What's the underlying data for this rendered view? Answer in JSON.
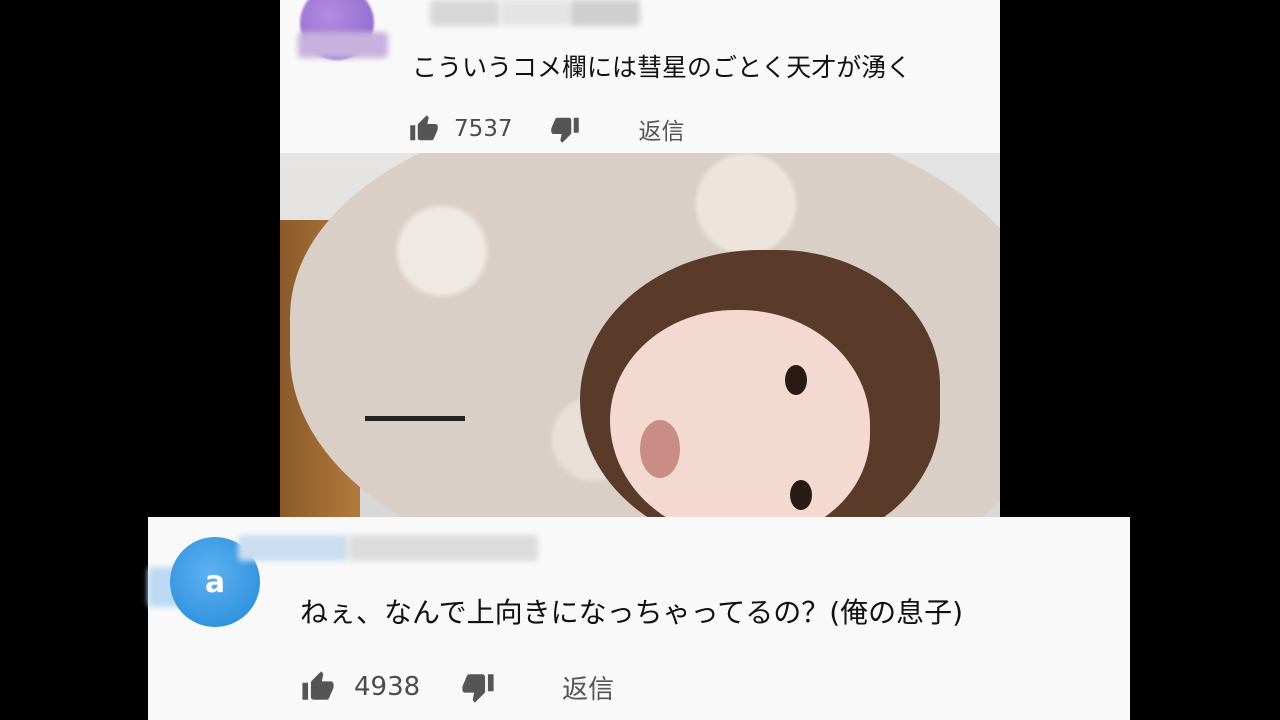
{
  "comments": [
    {
      "text": "こういうコメ欄には彗星のごとく天才が湧く",
      "likes": "7537",
      "reply_label": "返信",
      "avatar_color": "#9b74d6"
    },
    {
      "avatar_letter": "a",
      "text": "ねぇ、なんで上向きになっちゃってるの？(俺の息子)",
      "likes": "4938",
      "reply_label": "返信",
      "avatar_color": "#2f95de"
    }
  ],
  "icons": {
    "like": "thumb-up-icon",
    "dislike": "thumb-down-icon"
  }
}
